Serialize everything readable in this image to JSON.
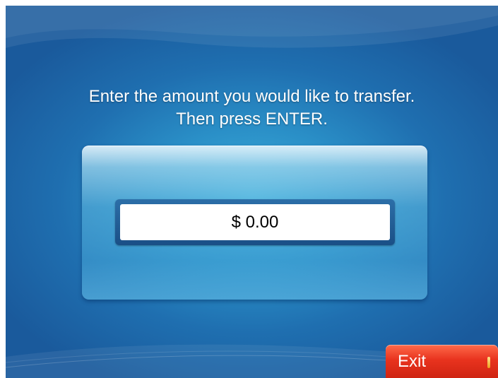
{
  "prompt": {
    "line1": "Enter the amount you would like to transfer.",
    "line2": "Then press ENTER."
  },
  "amount": {
    "value": "$ 0.00"
  },
  "exit": {
    "label": "Exit"
  },
  "colors": {
    "background": "#1f6fb0",
    "exit_button": "#e8331e",
    "field_border": "#1a4f86"
  }
}
